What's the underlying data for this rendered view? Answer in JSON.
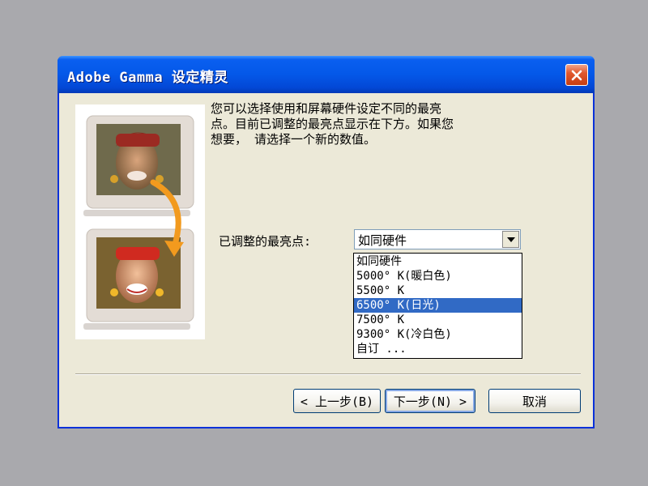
{
  "window": {
    "title": "Adobe Gamma 设定精灵"
  },
  "description": {
    "line1": "您可以选择使用和屏幕硬件设定不同的最亮",
    "line2": "点。目前已调整的最亮点显示在下方。如果您",
    "line3": "想要， 请选择一个新的数值。"
  },
  "whitepoint": {
    "label": "已调整的最亮点:",
    "selected": "如同硬件",
    "options": [
      "如同硬件",
      "5000° K(暖白色)",
      "5500° K",
      "6500° K(日光)",
      "7500° K",
      "9300° K(冷白色)",
      "自订 ..."
    ],
    "highlighted_index": 3
  },
  "buttons": {
    "back": "< 上一步(B)",
    "next": "下一步(N) >",
    "cancel": "取消"
  },
  "colors": {
    "titlebar": "#0458e8",
    "close": "#e2582e",
    "dialog_bg": "#ece9d8",
    "selection": "#316ac5",
    "desktop": "#a9a9ad"
  }
}
